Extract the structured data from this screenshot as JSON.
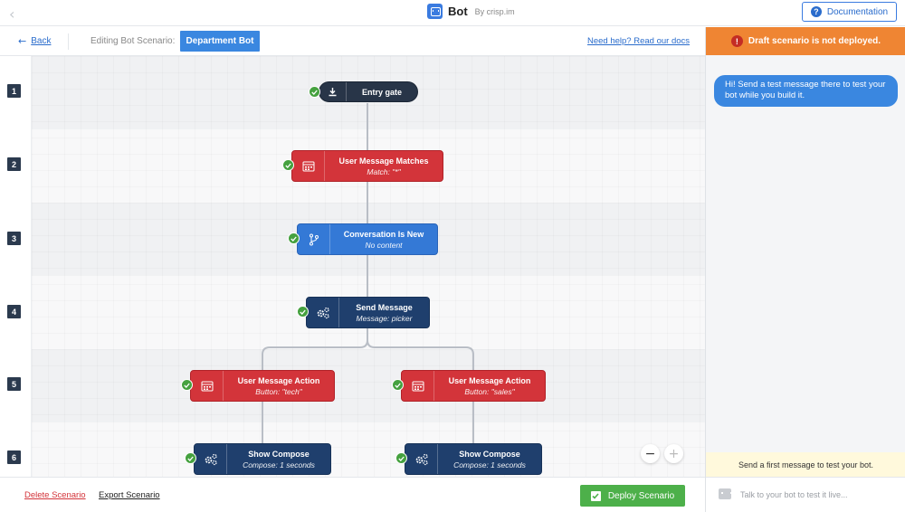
{
  "app": {
    "name": "Bot",
    "by": "By crisp.im"
  },
  "topbar": {
    "documentation_label": "Documentation"
  },
  "editor": {
    "back_label": "Back",
    "editing_label": "Editing Bot Scenario:",
    "bot_name": "Department Bot",
    "help_link": "Need help? Read our docs"
  },
  "rows": [
    "1",
    "2",
    "3",
    "4",
    "5",
    "6"
  ],
  "nodes": {
    "entry": {
      "title": "Entry gate",
      "icon": "download-icon"
    },
    "match": {
      "title": "User Message Matches",
      "sub": "Match: \"*\"",
      "icon": "calendar-icon"
    },
    "convo": {
      "title": "Conversation Is New",
      "sub": "No content",
      "icon": "branch-icon"
    },
    "send": {
      "title": "Send Message",
      "sub": "Message: picker",
      "icon": "gears-icon"
    },
    "action_tech": {
      "title": "User Message Action",
      "sub": "Button: \"tech\"",
      "icon": "calendar-icon"
    },
    "action_sales": {
      "title": "User Message Action",
      "sub": "Button: \"sales\"",
      "icon": "calendar-icon"
    },
    "compose_left": {
      "title": "Show Compose",
      "sub": "Compose: 1 seconds",
      "icon": "gears-icon"
    },
    "compose_right": {
      "title": "Show Compose",
      "sub": "Compose: 1 seconds",
      "icon": "gears-icon"
    }
  },
  "zoom": {
    "out": "−",
    "in": "+"
  },
  "footer": {
    "delete_label": "Delete Scenario",
    "export_label": "Export Scenario",
    "deploy_label": "Deploy Scenario"
  },
  "test_panel": {
    "draft_warning": "Draft scenario is not deployed.",
    "bot_message": "Hi! Send a test message there to test your bot while you build it.",
    "hint": "Send a first message to test your bot.",
    "input_placeholder": "Talk to your bot to test it live..."
  },
  "colors": {
    "accent": "#3a87e0",
    "condition_red": "#d3343a",
    "action_navy": "#1f3f6d",
    "entry_dark": "#283548",
    "success_green": "#4db04a",
    "warning_orange": "#ef8533"
  }
}
